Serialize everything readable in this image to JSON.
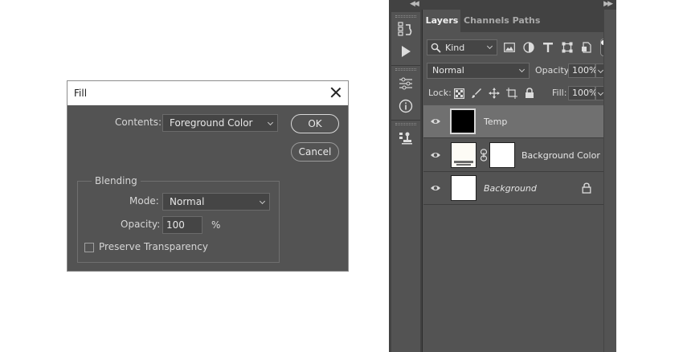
{
  "fill_dialog": {
    "title": "Fill",
    "contents_label": "Contents:",
    "contents_value": "Foreground Color",
    "ok_label": "OK",
    "cancel_label": "Cancel",
    "blending_label": "Blending",
    "mode_label": "Mode:",
    "mode_value": "Normal",
    "opacity_label": "Opacity:",
    "opacity_value": "100",
    "opacity_unit": "%",
    "preserve_label": "Preserve Transparency",
    "preserve_checked": false
  },
  "layers_panel": {
    "tabs": [
      {
        "label": "Layers",
        "active": true
      },
      {
        "label": "Channels",
        "active": false
      },
      {
        "label": "Paths",
        "active": false
      }
    ],
    "filter_kind": "Kind",
    "blend_mode": "Normal",
    "opacity_label": "Opacity:",
    "opacity_value": "100%",
    "lock_label": "Lock:",
    "fill_label": "Fill:",
    "fill_value": "100%",
    "layers": [
      {
        "name": "Temp",
        "selected": true,
        "italic": false,
        "thumb_color": "#000000"
      },
      {
        "name": "Background Color",
        "selected": false,
        "italic": false,
        "thumb_color": "#fdfbf5",
        "mask_color": "#ffffff",
        "has_link": true
      },
      {
        "name": "Background",
        "selected": false,
        "italic": true,
        "locked": true,
        "thumb_color": "#ffffff"
      }
    ]
  },
  "colors": {
    "panel_bg": "#535353",
    "dark_bg": "#424242",
    "selected_row": "#707070",
    "dialog_title_bg": "#ffffff"
  }
}
